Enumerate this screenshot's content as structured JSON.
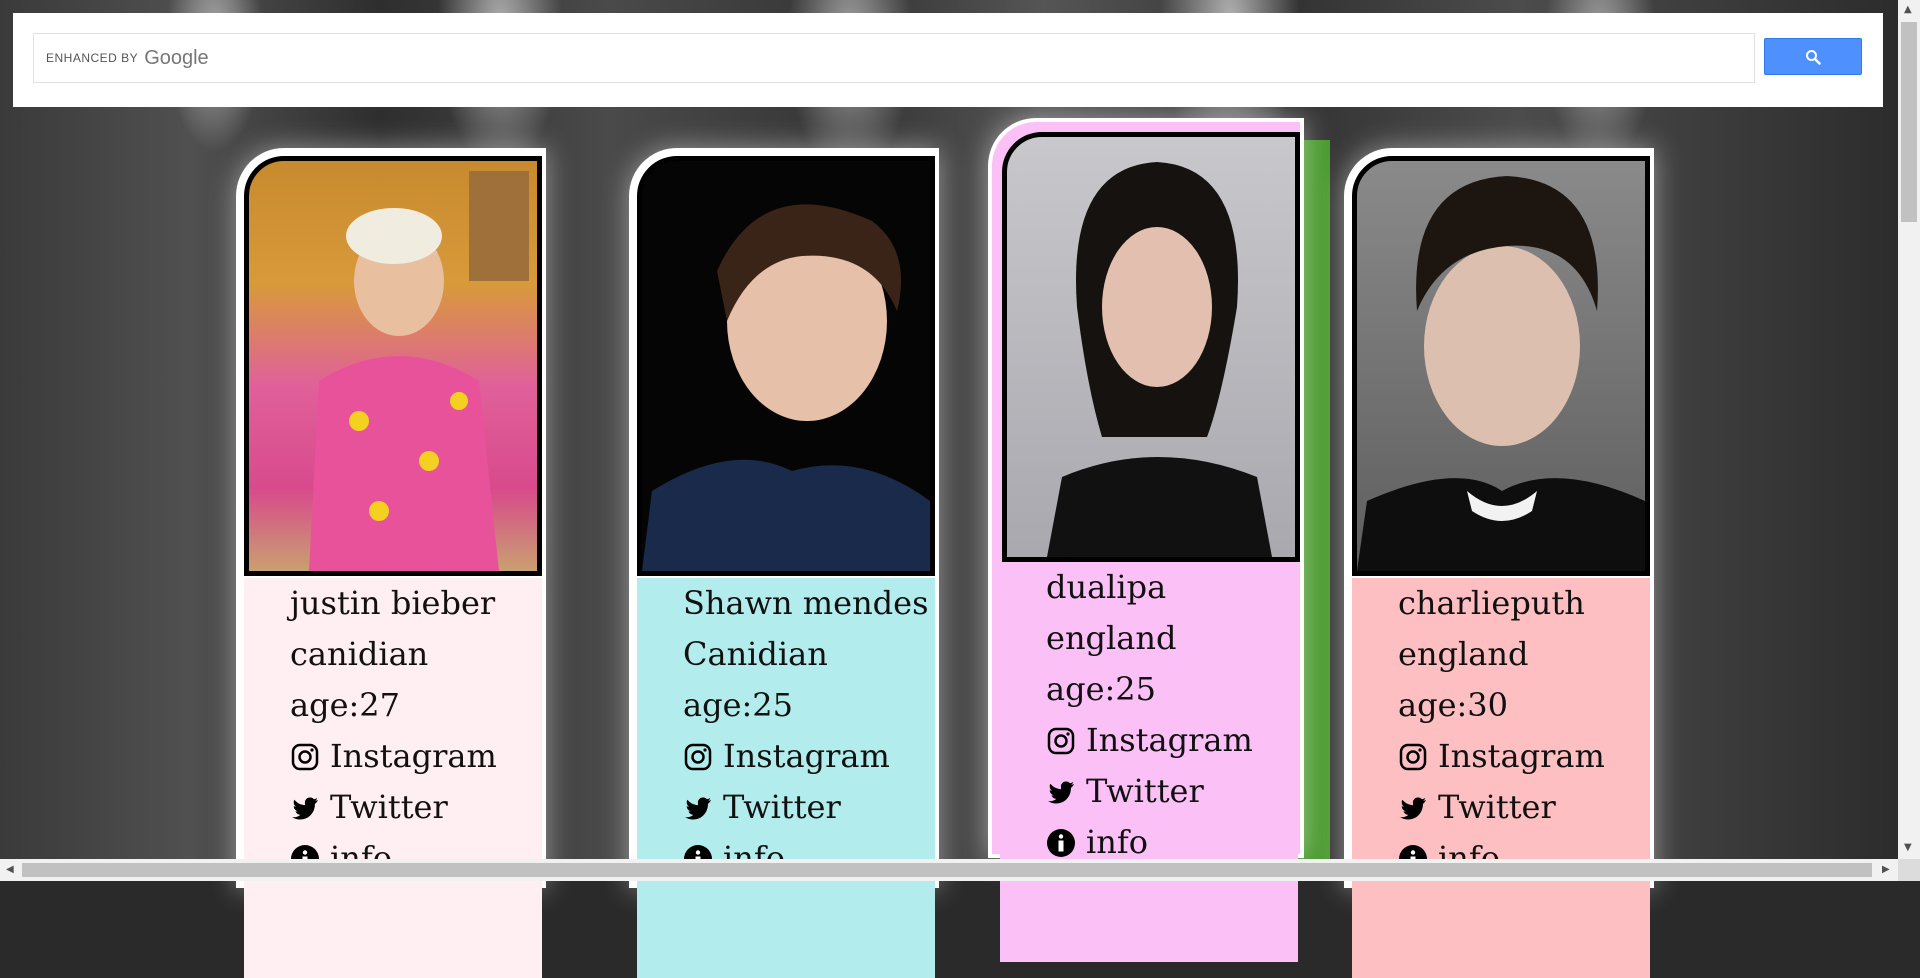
{
  "search": {
    "enhanced_label": "ENHANCED BY",
    "google_label": "Google"
  },
  "cards": [
    {
      "name": "justin bieber",
      "country": "canidian",
      "age": "age:27",
      "instagram": "Instagram",
      "twitter": "Twitter",
      "info": "info",
      "color": "#ffeef2"
    },
    {
      "name": "Shawn mendes",
      "country": "Canidian",
      "age": "age:25",
      "instagram": "Instagram",
      "twitter": "Twitter",
      "info": "info",
      "color": "#b3eced"
    },
    {
      "name": "dualipa",
      "country": "england",
      "age": "age:25",
      "instagram": "Instagram",
      "twitter": "Twitter",
      "info": "info",
      "color": "#fbc0f6"
    },
    {
      "name": "charlieputh",
      "country": "england",
      "age": "age:30",
      "instagram": "Instagram",
      "twitter": "Twitter",
      "info": "info",
      "color": "#fdbfc1"
    }
  ]
}
